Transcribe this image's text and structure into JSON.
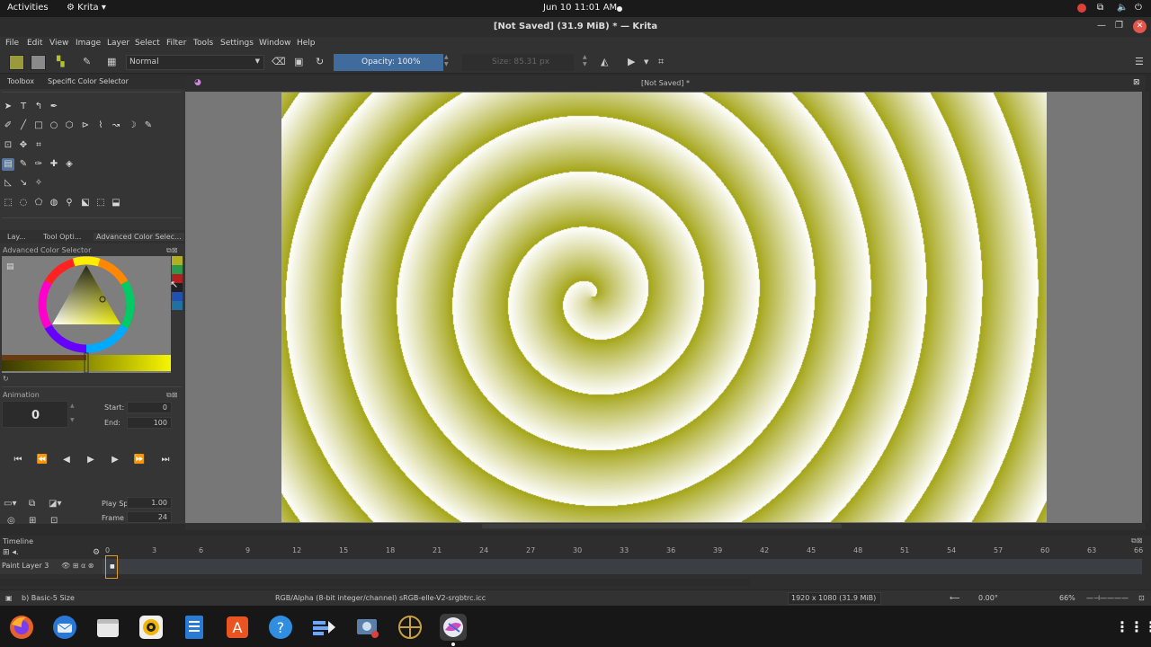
{
  "system_bar": {
    "activities": "Activities",
    "app_name": "Krita",
    "clock": "Jun 10  11:01 AM"
  },
  "window": {
    "title": "[Not Saved]  (31.9 MiB)  * — Krita"
  },
  "menu": [
    "File",
    "Edit",
    "View",
    "Image",
    "Layer",
    "Select",
    "Filter",
    "Tools",
    "Settings",
    "Window",
    "Help"
  ],
  "toolbar": {
    "blend_mode": "Normal",
    "opacity_label": "Opacity: 100%",
    "size_label": "Size: 85.31 px",
    "colors": {
      "foreground": "#9b9a3a",
      "background": "#8a8a8a"
    }
  },
  "left_docker": {
    "tabs": [
      "Toolbox",
      "Specific Color Selector"
    ],
    "tabs2": [
      "Lay...",
      "Tool Opti...",
      "Advanced Color Selec..."
    ],
    "acs_title": "Advanced Color Selector",
    "animation": {
      "title": "Animation",
      "current_frame": "0",
      "start_label": "Start:",
      "start_value": "0",
      "end_label": "End:",
      "end_value": "100",
      "play_speed_label": "Play Speed:",
      "play_speed_value": "1.00",
      "frame_rate_label": "Frame Rate:",
      "frame_rate_value": "24"
    }
  },
  "canvas": {
    "tab_title": "[Not Saved]  *",
    "spiral_colors": {
      "dark": "#a3a414",
      "light": "#ffffff"
    }
  },
  "timeline": {
    "title": "Timeline",
    "ruler": [
      "0",
      "3",
      "6",
      "9",
      "12",
      "15",
      "18",
      "21",
      "24",
      "27",
      "30",
      "33",
      "36",
      "39",
      "42",
      "45",
      "48",
      "51",
      "54",
      "57",
      "60",
      "63",
      "66"
    ],
    "layer_name": "Paint Layer 3"
  },
  "status": {
    "brush": "b) Basic-5 Size",
    "color_profile": "RGB/Alpha (8-bit integer/channel)  sRGB-elle-V2-srgbtrc.icc",
    "image_size": "1920 x 1080 (31.9 MiB)",
    "rotation": "0.00°",
    "zoom": "66%"
  }
}
